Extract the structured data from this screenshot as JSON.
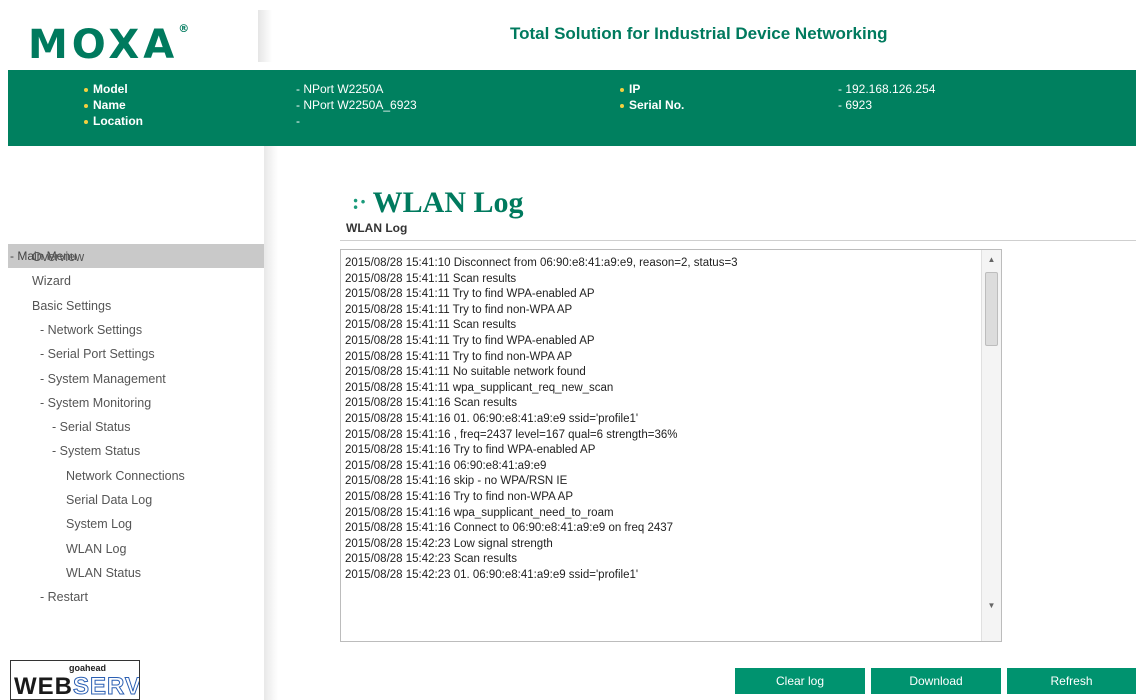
{
  "header": {
    "logo_text": "MOXA",
    "logo_mark": "®",
    "tagline": "Total Solution for Industrial Device Networking"
  },
  "device_info": {
    "model_label": "Model",
    "model_value": "- NPort W2250A",
    "name_label": "Name",
    "name_value": "- NPort W2250A_6923",
    "location_label": "Location",
    "location_value": "-",
    "ip_label": "IP",
    "ip_value": "- 192.168.126.254",
    "serial_label": "Serial No.",
    "serial_value": "- 6923"
  },
  "sidebar": {
    "main_menu": "- Main Menu",
    "items": [
      {
        "label": "Overview",
        "indent": 0
      },
      {
        "label": "Wizard",
        "indent": 0
      },
      {
        "label": "Basic Settings",
        "indent": 0
      },
      {
        "label": "- Network Settings",
        "indent": 1
      },
      {
        "label": "- Serial Port Settings",
        "indent": 1
      },
      {
        "label": "- System Management",
        "indent": 1
      },
      {
        "label": "- System Monitoring",
        "indent": 1
      },
      {
        "label": "- Serial Status",
        "indent": 2
      },
      {
        "label": "- System Status",
        "indent": 2
      },
      {
        "label": "Network Connections",
        "indent": 3
      },
      {
        "label": "Serial Data Log",
        "indent": 3
      },
      {
        "label": "System Log",
        "indent": 3
      },
      {
        "label": "WLAN Log",
        "indent": 3
      },
      {
        "label": "WLAN Status",
        "indent": 3
      },
      {
        "label": "- Restart",
        "indent": 1
      }
    ],
    "webserver_small": "goahead",
    "webserver_web": "WEB",
    "webserver_server": "SERVER"
  },
  "main": {
    "title": "WLAN Log",
    "section_title": "WLAN Log",
    "log_lines": [
      "2015/08/28 15:41:10 Disconnect from 06:90:e8:41:a9:e9, reason=2, status=3",
      "2015/08/28 15:41:11 Scan results",
      "2015/08/28 15:41:11 Try to find WPA-enabled AP",
      "2015/08/28 15:41:11 Try to find non-WPA AP",
      "2015/08/28 15:41:11 Scan results",
      "2015/08/28 15:41:11 Try to find WPA-enabled AP",
      "2015/08/28 15:41:11 Try to find non-WPA AP",
      "2015/08/28 15:41:11 No suitable network found",
      "2015/08/28 15:41:11 wpa_supplicant_req_new_scan",
      "2015/08/28 15:41:16 Scan results",
      "2015/08/28 15:41:16 01. 06:90:e8:41:a9:e9 ssid='profile1'",
      "2015/08/28 15:41:16 ,  freq=2437 level=167 qual=6 strength=36%",
      "2015/08/28 15:41:16 Try to find WPA-enabled AP",
      "2015/08/28 15:41:16 06:90:e8:41:a9:e9",
      "2015/08/28 15:41:16 skip - no WPA/RSN IE",
      "2015/08/28 15:41:16 Try to find non-WPA AP",
      "2015/08/28 15:41:16 wpa_supplicant_need_to_roam",
      "2015/08/28 15:41:16 Connect to 06:90:e8:41:a9:e9 on freq 2437",
      "2015/08/28 15:42:23 Low signal strength",
      "2015/08/28 15:42:23 Scan results",
      "2015/08/28 15:42:23 01. 06:90:e8:41:a9:e9 ssid='profile1'"
    ],
    "buttons": {
      "clear": "Clear log",
      "download": "Download",
      "refresh": "Refresh"
    }
  },
  "colors": {
    "brand_green": "#007a5e",
    "infobar_green": "#00805f",
    "button_green": "#00936f"
  }
}
